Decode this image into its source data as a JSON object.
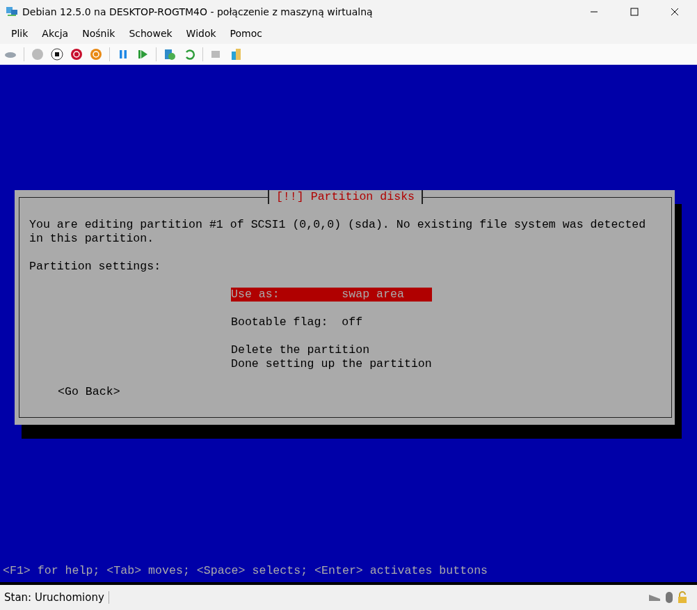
{
  "window": {
    "title": "Debian 12.5.0 na DESKTOP-ROGTM4O - połączenie z maszyną wirtualną"
  },
  "menu": [
    "Plik",
    "Akcja",
    "Nośnik",
    "Schowek",
    "Widok",
    "Pomoc"
  ],
  "dialog": {
    "title": "[!!] Partition disks",
    "message": "You are editing partition #1 of SCSI1 (0,0,0) (sda). No existing file system was detected in this partition.",
    "section_label": "Partition settings:",
    "items": [
      {
        "kind": "setting",
        "label": "Use as:",
        "value": "swap area",
        "selected": true
      },
      {
        "kind": "setting",
        "label": "Bootable flag:",
        "value": "off",
        "selected": false
      },
      {
        "kind": "spacer"
      },
      {
        "kind": "action",
        "label": "Delete the partition",
        "selected": false
      },
      {
        "kind": "action",
        "label": "Done setting up the partition",
        "selected": false
      }
    ],
    "back_button": "<Go Back>"
  },
  "help_line": "<F1> for help; <Tab> moves; <Space> selects; <Enter> activates buttons",
  "status_bar": {
    "status": "Stan: Uruchomiony"
  }
}
